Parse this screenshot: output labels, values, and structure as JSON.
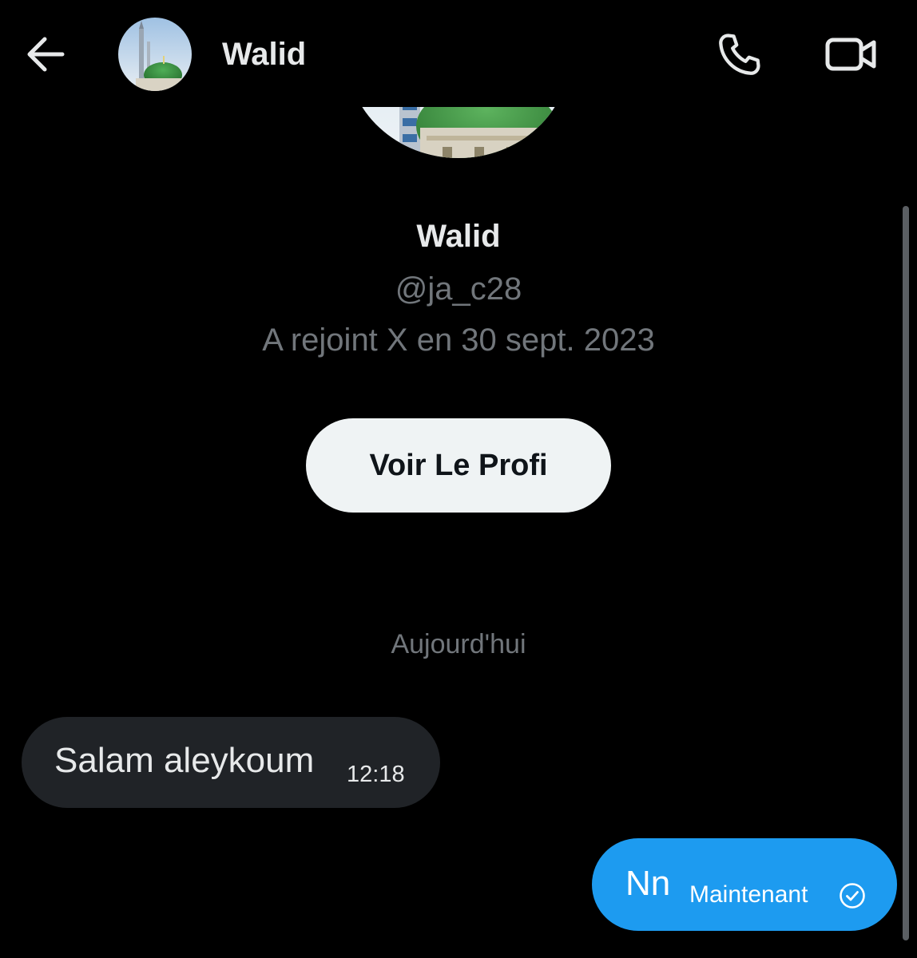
{
  "header": {
    "title": "Walid",
    "back_icon": "arrow-left-icon",
    "call_icon": "phone-icon",
    "video_icon": "video-camera-icon"
  },
  "profile": {
    "name": "Walid",
    "handle": "@ja_c28",
    "joined": "A rejoint X en 30 sept. 2023",
    "view_profile_label": "Voir Le Profi"
  },
  "conversation": {
    "date_divider": "Aujourd'hui",
    "messages": [
      {
        "direction": "incoming",
        "text": "Salam aleykoum",
        "time": "12:18"
      },
      {
        "direction": "outgoing",
        "text": "Nn",
        "time": "Maintenant",
        "status_icon": "read-check-icon"
      }
    ]
  },
  "colors": {
    "background": "#000000",
    "primary_text": "#e7e9ea",
    "secondary_text": "#71767b",
    "incoming_bubble": "#202327",
    "outgoing_bubble": "#1d9bf0",
    "button_bg": "#eff3f4"
  }
}
